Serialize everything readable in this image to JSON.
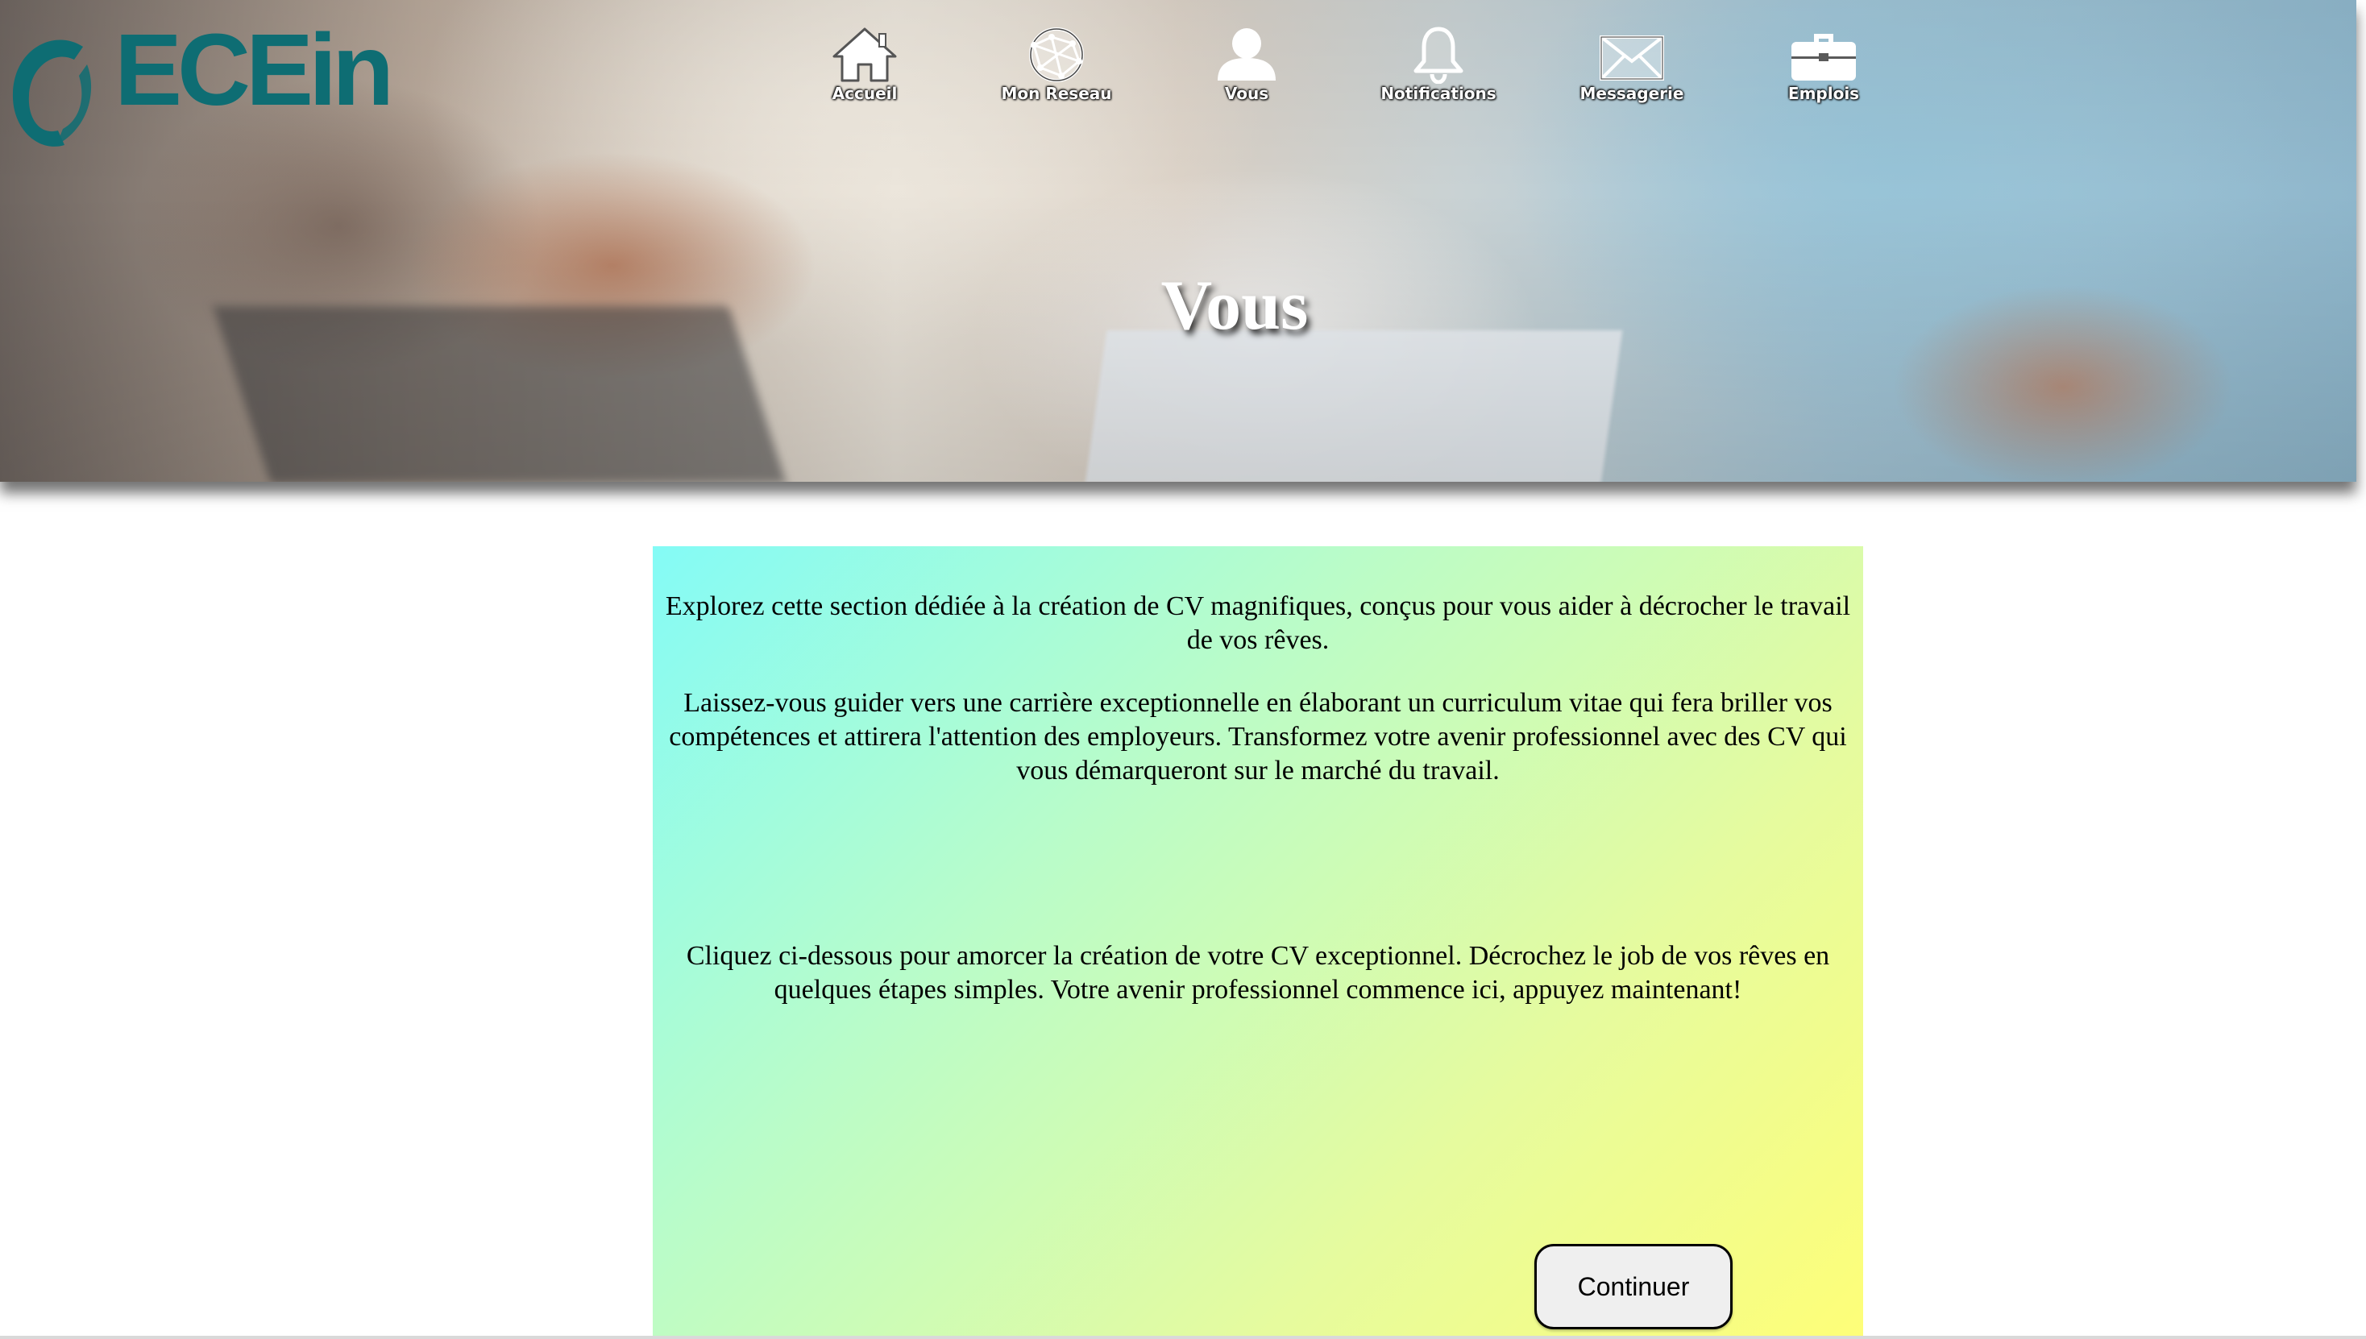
{
  "logo": {
    "text": "ECEin",
    "color": "#0e6d73"
  },
  "nav": {
    "items": [
      {
        "label": "Accueil",
        "icon": "home-icon"
      },
      {
        "label": "Mon Reseau",
        "icon": "network-globe-icon"
      },
      {
        "label": "Vous",
        "icon": "user-icon"
      },
      {
        "label": "Notifications",
        "icon": "bell-icon"
      },
      {
        "label": "Messagerie",
        "icon": "envelope-icon"
      },
      {
        "label": "Emplois",
        "icon": "briefcase-icon"
      }
    ]
  },
  "hero": {
    "title": "Vous"
  },
  "panel": {
    "paragraph1": "Explorez cette section dédiée à la création de CV magnifiques, conçus pour vous aider à décrocher le travail de vos rêves.",
    "paragraph2": "Laissez-vous guider vers une carrière exceptionnelle en élaborant un curriculum vitae qui fera briller vos compétences et attirera l'attention des employeurs. Transformez votre avenir professionnel avec des CV qui vous démarqueront sur le marché du travail.",
    "paragraph3": "Cliquez ci-dessous pour amorcer la création de votre CV exceptionnel. Décrochez le job de vos rêves en quelques étapes simples. Votre avenir professionnel commence ici, appuyez maintenant!",
    "continue_label": "Continuer",
    "gradient_start": "#84fbf6",
    "gradient_end": "#fefe78"
  }
}
